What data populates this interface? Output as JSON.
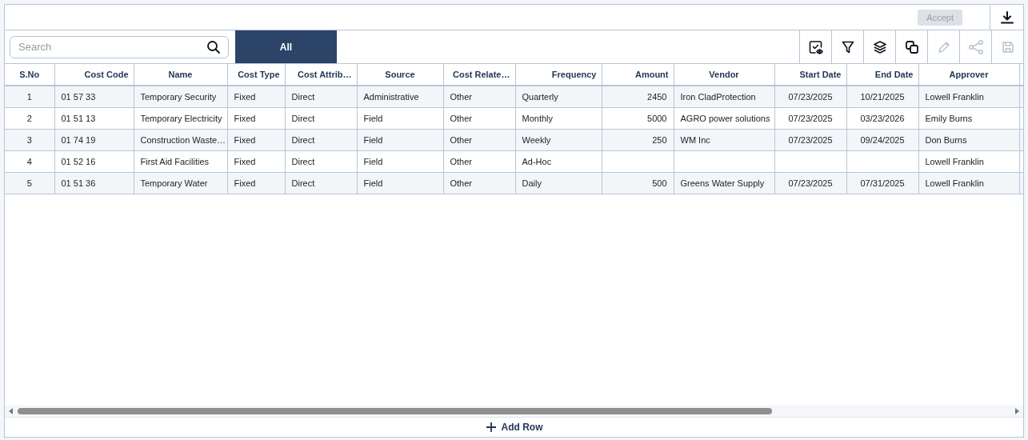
{
  "top_bar": {
    "accept_button": {
      "label": "Accept",
      "disabled": true
    }
  },
  "toolbar": {
    "search": {
      "placeholder": "Search"
    },
    "tabs": [
      {
        "label": "All",
        "selected": true
      }
    ],
    "tools": [
      {
        "kind": "view",
        "disabled": false
      },
      {
        "kind": "filter",
        "disabled": false
      },
      {
        "kind": "layers",
        "disabled": false
      },
      {
        "kind": "copy",
        "disabled": false
      },
      {
        "kind": "edit",
        "disabled": true
      },
      {
        "kind": "share",
        "disabled": true
      },
      {
        "kind": "save",
        "disabled": true
      }
    ]
  },
  "table": {
    "columns": [
      "S.No",
      "Cost Code",
      "Name",
      "Cost Type",
      "Cost Attrib…",
      "Source",
      "Cost Relate…",
      "Frequency",
      "Amount",
      "Vendor",
      "Start Date",
      "End Date",
      "Approver"
    ],
    "rows": [
      [
        "1",
        "01 57 33",
        "Temporary Security",
        "Fixed",
        "Direct",
        "Administrative",
        "Other",
        "Quarterly",
        "2450",
        "Iron CladProtection",
        "07/23/2025",
        "10/21/2025",
        "Lowell Franklin"
      ],
      [
        "2",
        "01 51 13",
        "Temporary Electricity",
        "Fixed",
        "Direct",
        "Field",
        "Other",
        "Monthly",
        "5000",
        "AGRO power solutions",
        "07/23/2025",
        "03/23/2026",
        "Emily Burns"
      ],
      [
        "3",
        "01 74 19",
        "Construction Waste…",
        "Fixed",
        "Direct",
        "Field",
        "Other",
        "Weekly",
        "250",
        "WM Inc",
        "07/23/2025",
        "09/24/2025",
        "Don Burns"
      ],
      [
        "4",
        "01 52 16",
        "First Aid Facilities",
        "Fixed",
        "Direct",
        "Field",
        "Other",
        "Ad-Hoc",
        "",
        "",
        "",
        "",
        "Lowell Franklin"
      ],
      [
        "5",
        "01 51 36",
        "Temporary Water",
        "Fixed",
        "Direct",
        "Field",
        "Other",
        "Daily",
        "500",
        "Greens Water Supply",
        "07/23/2025",
        "07/31/2025",
        "Lowell Franklin"
      ]
    ]
  },
  "add_row_button": {
    "label": "Add Row"
  }
}
